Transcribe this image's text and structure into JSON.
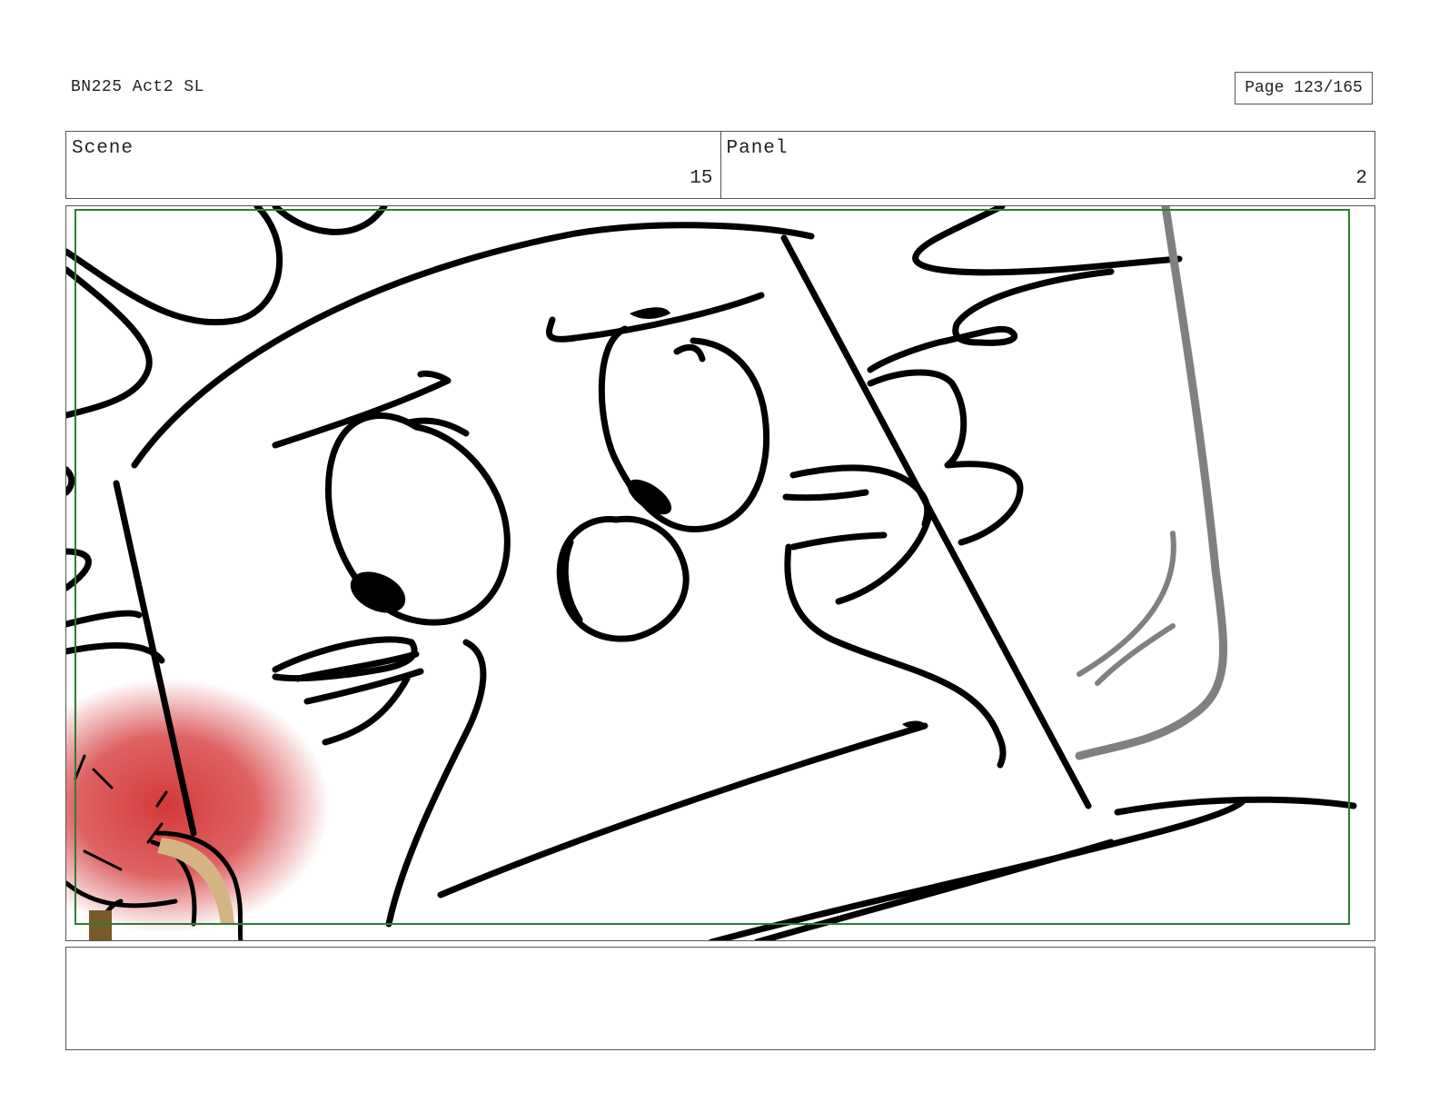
{
  "header": {
    "document_title": "BN225 Act2 SL",
    "page_label": "Page 123/165"
  },
  "info": {
    "scene_label": "Scene",
    "scene_value": "15",
    "panel_label": "Panel",
    "panel_value": "2"
  },
  "notes": {
    "text": ""
  },
  "colors": {
    "safe_frame": "#2e7d32",
    "ink": "#000000",
    "blush": "#d32f2f",
    "tan": "#d4b483",
    "grey_stroke": "#808080"
  }
}
